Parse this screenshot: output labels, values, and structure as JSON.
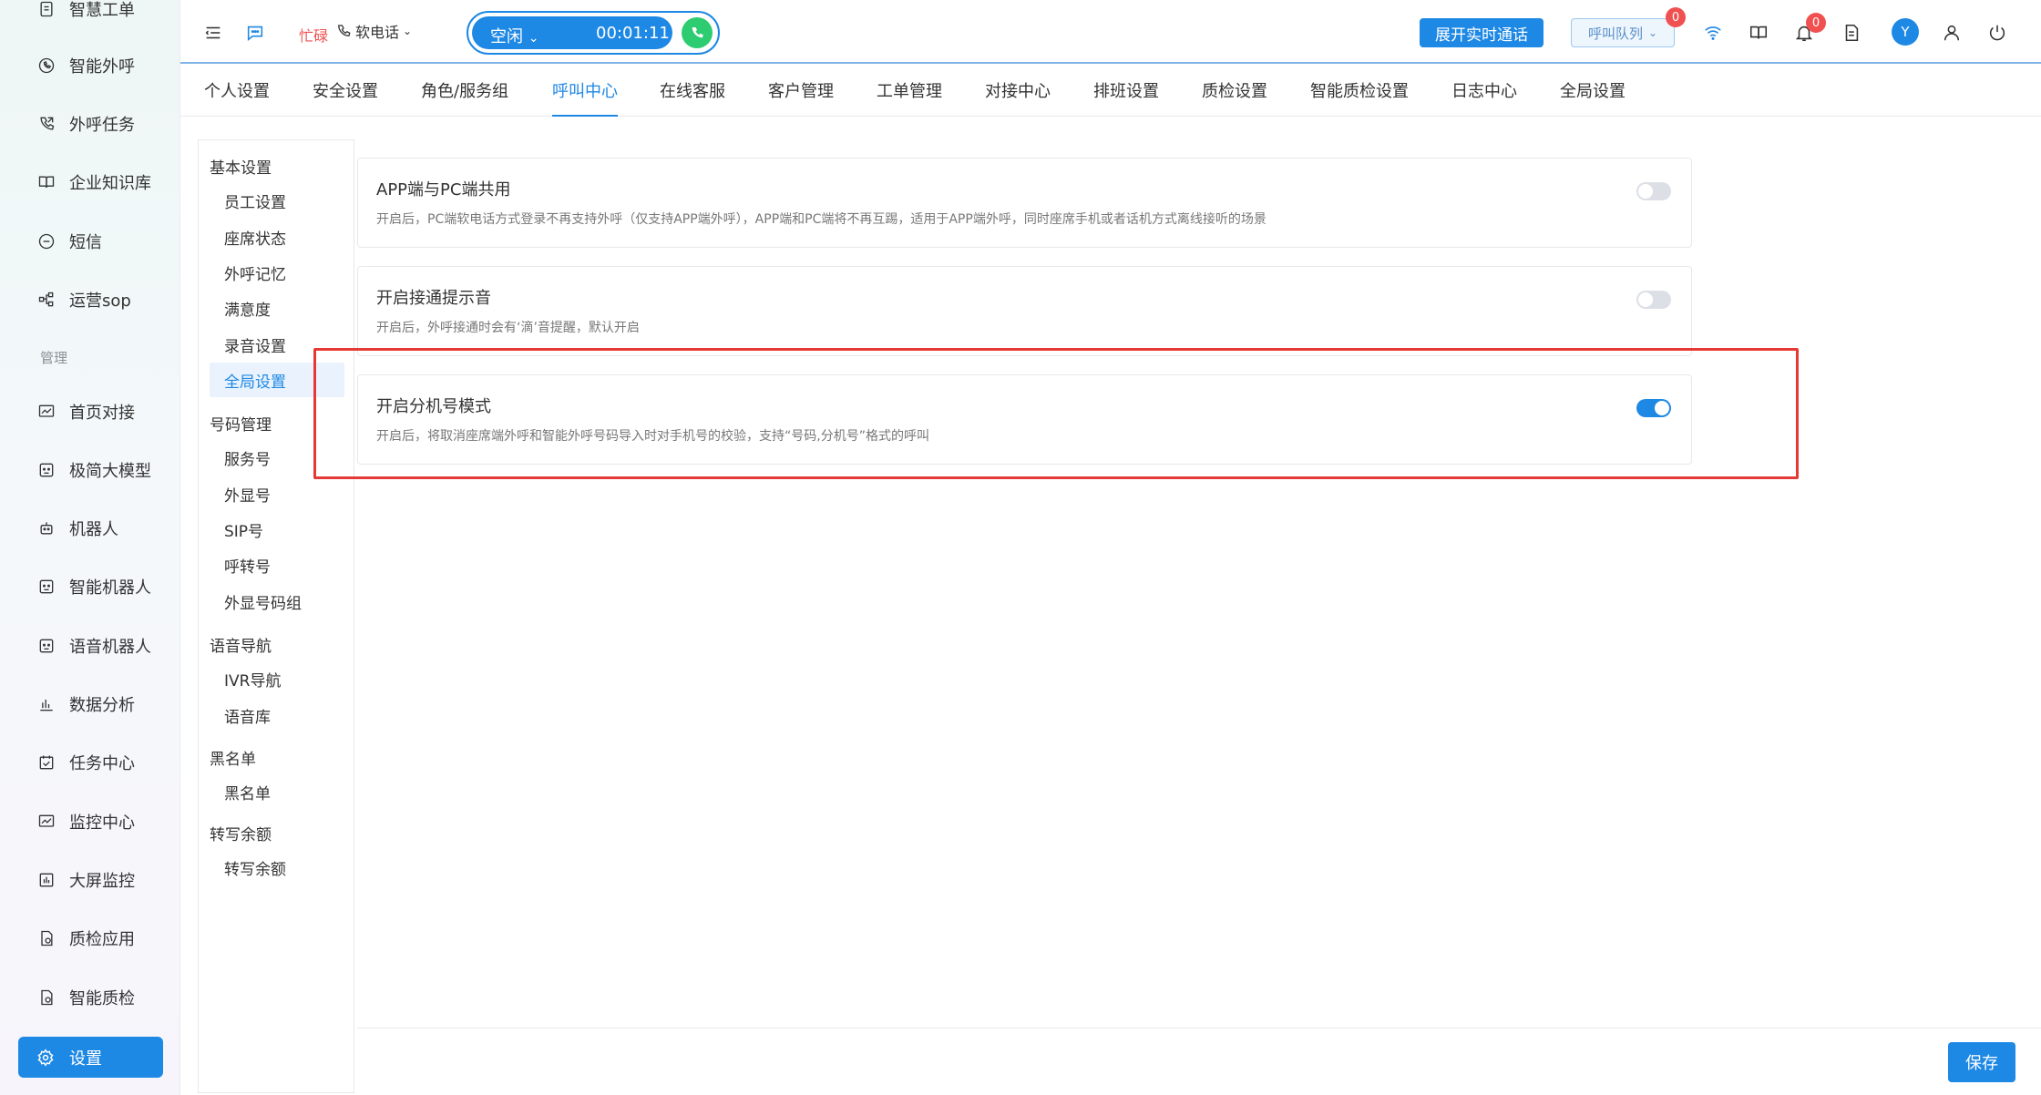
{
  "sidebar": {
    "top_items": [
      {
        "label": "智慧工单",
        "icon": "document-icon"
      },
      {
        "label": "智能外呼",
        "icon": "phone-icon"
      },
      {
        "label": "外呼任务",
        "icon": "phone-outgoing-icon"
      },
      {
        "label": "企业知识库",
        "icon": "book-icon"
      },
      {
        "label": "短信",
        "icon": "sms-icon"
      },
      {
        "label": "运营sop",
        "icon": "flow-icon"
      }
    ],
    "section_label": "管理",
    "manage_items": [
      {
        "label": "首页对接",
        "icon": "chart-icon"
      },
      {
        "label": "极简大模型",
        "icon": "robot-face-icon"
      },
      {
        "label": "机器人",
        "icon": "robot-icon"
      },
      {
        "label": "智能机器人",
        "icon": "robot-face-icon"
      },
      {
        "label": "语音机器人",
        "icon": "robot-face-icon"
      },
      {
        "label": "数据分析",
        "icon": "bar-chart-icon"
      },
      {
        "label": "任务中心",
        "icon": "calendar-check-icon"
      },
      {
        "label": "监控中心",
        "icon": "monitor-chart-icon"
      },
      {
        "label": "大屏监控",
        "icon": "bar-chart-box-icon"
      },
      {
        "label": "质检应用",
        "icon": "file-check-icon"
      },
      {
        "label": "智能质检",
        "icon": "file-check-icon"
      }
    ],
    "settings_label": "设置"
  },
  "topbar": {
    "busy_text": "忙碌",
    "softphone_label": "软电话",
    "status_label": "空闲",
    "timer": "00:01:11",
    "realtime_button": "展开实时通话",
    "queue_select": "呼叫队列",
    "queue_badge": "0",
    "notify_badge": "0",
    "avatar_letter": "Y"
  },
  "tabs": [
    "个人设置",
    "安全设置",
    "角色/服务组",
    "呼叫中心",
    "在线客服",
    "客户管理",
    "工单管理",
    "对接中心",
    "排班设置",
    "质检设置",
    "智能质检设置",
    "日志中心",
    "全局设置"
  ],
  "active_tab": "呼叫中心",
  "submenu": {
    "basic": {
      "title": "基本设置",
      "items": [
        "员工设置",
        "座席状态",
        "外呼记忆",
        "满意度",
        "录音设置",
        "全局设置"
      ]
    },
    "number": {
      "title": "号码管理",
      "items": [
        "服务号",
        "外显号",
        "SIP号",
        "呼转号",
        "外显号码组"
      ]
    },
    "voice": {
      "title": "语音导航",
      "items": [
        "IVR导航",
        "语音库"
      ]
    },
    "blacklist": {
      "title": "黑名单",
      "items": [
        "黑名单"
      ]
    },
    "transcribe": {
      "title": "转写余额",
      "items": [
        "转写余额"
      ]
    },
    "active_item": "全局设置"
  },
  "settings_cards": [
    {
      "title": "APP端与PC端共用",
      "desc": "开启后，PC端软电话方式登录不再支持外呼（仅支持APP端外呼），APP端和PC端将不再互踢，适用于APP端外呼，同时座席手机或者话机方式离线接听的场景",
      "enabled": false
    },
    {
      "title": "开启接通提示音",
      "desc": "开启后，外呼接通时会有‘滴’音提醒，默认开启",
      "enabled": false
    },
    {
      "title": "开启分机号模式",
      "desc": "开启后，将取消座席端外呼和智能外呼号码导入时对手机号的校验，支持“号码,分机号”格式的呼叫",
      "enabled": true
    }
  ],
  "save_button": "保存",
  "colors": {
    "primary": "#1e88e5",
    "highlight": "#e53935",
    "badge": "#f05050",
    "call_green": "#2ecc71"
  }
}
